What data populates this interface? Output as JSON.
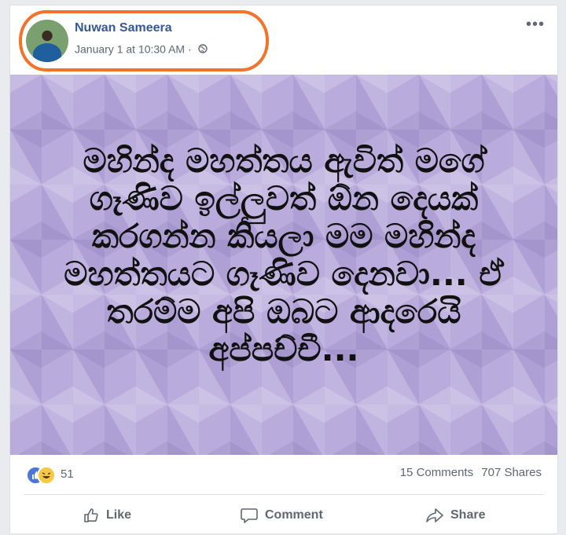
{
  "post": {
    "author": "Nuwan Sameera",
    "timestamp": "January 1 at 10:30 AM",
    "separator": "·",
    "privacy_icon": "globe-icon",
    "options_icon": "•••",
    "image_text": "මහින්ද මහත්තය ඇවිත් මගේ ගෑණිව ඉල්ලුවත් ඕන දෙයක් කරගන්න කියලා මම මහින්ද මහත්තයට ගෑණිව දෙනවා... ඒ තරම්ම අපි ඔබට ආදරෙයි අප්පච්චී..."
  },
  "stats": {
    "reaction_icons": [
      "like-reaction-icon",
      "haha-reaction-icon"
    ],
    "reaction_count": "51",
    "comments": "15 Comments",
    "shares": "707 Shares"
  },
  "actions": {
    "like": "Like",
    "comment": "Comment",
    "share": "Share"
  },
  "colors": {
    "author": "#365899",
    "annotation": "#f3732a",
    "image_background": "#b9acdc",
    "like_blue": "#4a77d8",
    "haha_yellow": "#f6c944"
  }
}
